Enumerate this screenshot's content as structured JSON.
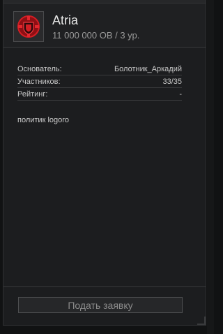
{
  "header": {
    "emblem_icon": "clan-shield-icon",
    "name": "Atria",
    "subtitle": "11 000 000 ОВ / 3 ур."
  },
  "info": {
    "rows": [
      {
        "label": "Основатель:",
        "value": "Болотник_Аркадий"
      },
      {
        "label": "Участников:",
        "value": "33/35"
      },
      {
        "label": "Рейтинг:",
        "value": "-"
      }
    ]
  },
  "description": "политик logoro",
  "footer": {
    "apply_label": "Подать заявку"
  },
  "colors": {
    "emblem": "#c0161c",
    "background": "#1c1d1f"
  }
}
